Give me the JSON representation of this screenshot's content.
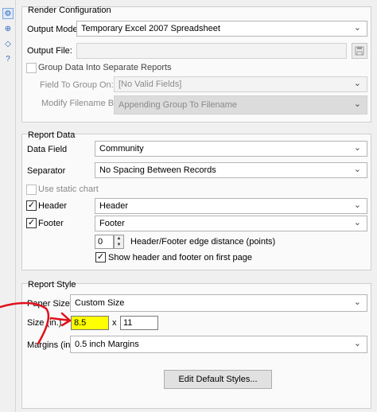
{
  "sidebar": {
    "icons": [
      "gear-icon",
      "settings-plus-icon",
      "tag-icon",
      "help-icon"
    ]
  },
  "render": {
    "title": "Render Configuration",
    "output_mode_label": "Output Mode:",
    "output_mode_value": "Temporary Excel 2007 Spreadsheet",
    "output_file_label": "Output File:",
    "output_file_value": "",
    "group_data_label": "Group Data Into Separate Reports",
    "group_data_checked": false,
    "field_to_group_label": "Field To Group On:",
    "field_to_group_value": "[No Valid Fields]",
    "modify_filename_label": "Modify Filename By:",
    "modify_filename_value": "Appending Group To Filename"
  },
  "report_data": {
    "title": "Report Data",
    "data_field_label": "Data Field",
    "data_field_value": "Community",
    "separator_label": "Separator",
    "separator_value": "No Spacing Between Records",
    "static_chart_label": "Use static chart",
    "header_label": "Header",
    "header_checked": true,
    "header_value": "Header",
    "footer_label": "Footer",
    "footer_checked": true,
    "footer_value": "Footer",
    "edge_distance_value": "0",
    "edge_distance_label": "Header/Footer edge distance (points)",
    "show_first_page_label": "Show header and footer on first page",
    "show_first_page_checked": true
  },
  "report_style": {
    "title": "Report Style",
    "paper_size_label": "Paper Size",
    "paper_size_value": "Custom Size",
    "size_label": "Size (in.)",
    "width_value": "8.5",
    "size_separator": "x",
    "height_value": "11",
    "margins_label": "Margins (in.)",
    "margins_value": "0.5 inch Margins",
    "edit_styles_button": "Edit Default Styles..."
  },
  "colors": {
    "highlight": "#ffff00",
    "annotation": "#e0101a",
    "accent": "#2a62b8"
  }
}
